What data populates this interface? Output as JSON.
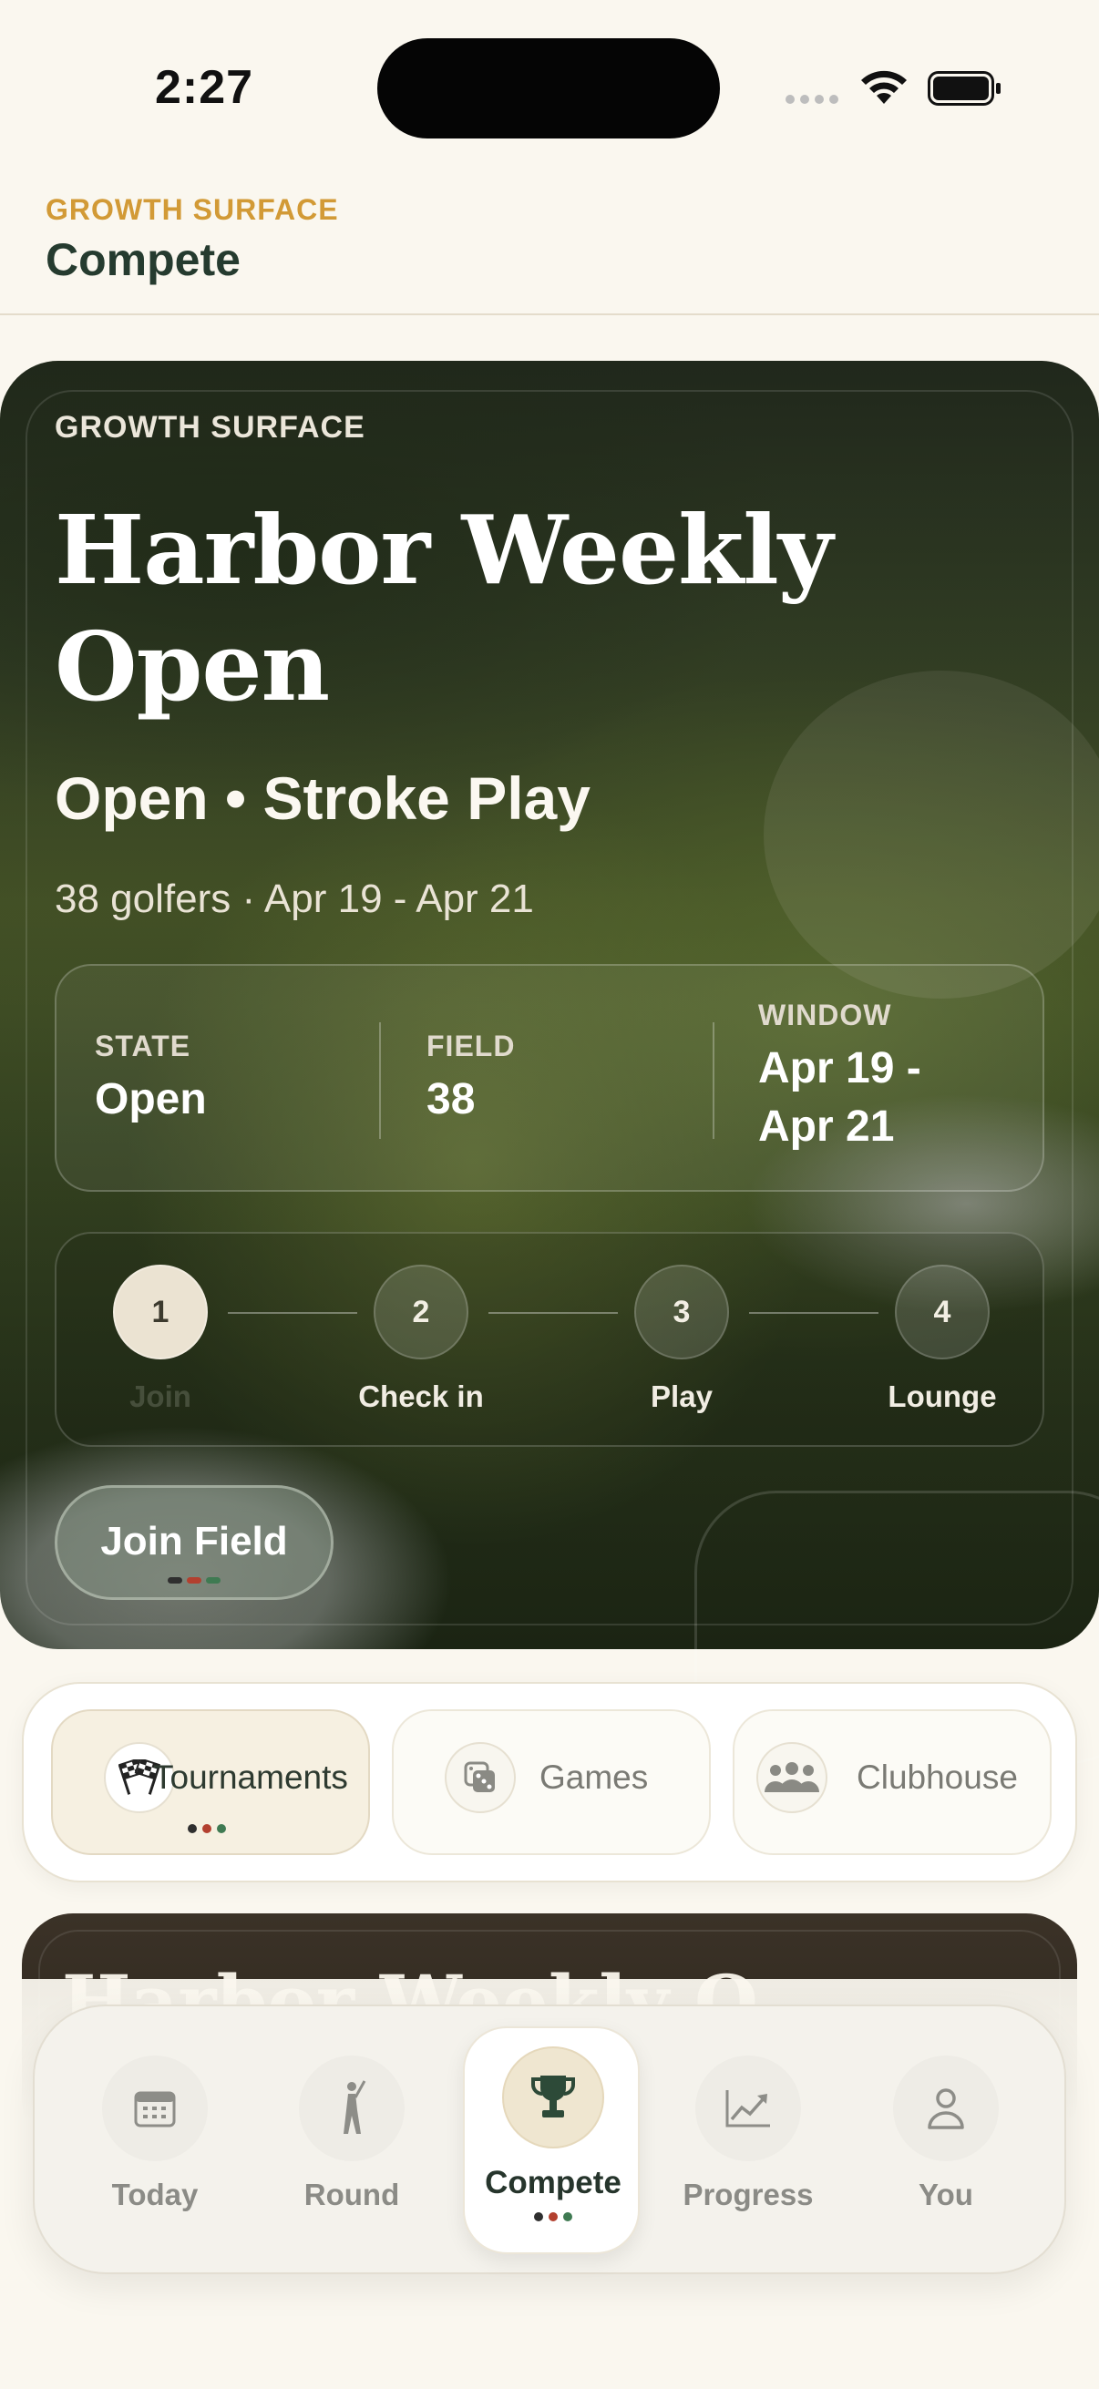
{
  "status_bar": {
    "time": "2:27"
  },
  "header": {
    "eyebrow": "GROWTH SURFACE",
    "title": "Compete"
  },
  "hero": {
    "eyebrow": "GROWTH SURFACE",
    "title": "Harbor Weekly Open",
    "subtitle": "Open • Stroke Play",
    "meta": "38 golfers · Apr 19 - Apr 21",
    "stats": [
      {
        "label": "STATE",
        "value": "Open"
      },
      {
        "label": "FIELD",
        "value": "38"
      },
      {
        "label": "WINDOW",
        "value": "Apr 19 - Apr 21"
      }
    ],
    "steps": [
      {
        "number": "1",
        "label": "Join",
        "active": true
      },
      {
        "number": "2",
        "label": "Check in"
      },
      {
        "number": "3",
        "label": "Play"
      },
      {
        "number": "4",
        "label": "Lounge"
      }
    ],
    "cta_label": "Join Field"
  },
  "segments": [
    {
      "label": "Tournaments",
      "icon": "checkered-flags-icon",
      "selected": true
    },
    {
      "label": "Games",
      "icon": "dice-icon"
    },
    {
      "label": "Clubhouse",
      "icon": "people-icon"
    }
  ],
  "next_card": {
    "title_partial": "Harbor Weekly O..."
  },
  "bottom_nav": [
    {
      "label": "Today",
      "icon": "calendar-icon"
    },
    {
      "label": "Round",
      "icon": "golfer-icon"
    },
    {
      "label": "Compete",
      "icon": "trophy-icon",
      "selected": true
    },
    {
      "label": "Progress",
      "icon": "trend-chart-icon"
    },
    {
      "label": "You",
      "icon": "person-icon"
    }
  ],
  "colors": {
    "accent_gold": "#d29a36",
    "title_green": "#253b2f",
    "indicator_dark": "#2f2f2f",
    "indicator_red": "#b3402f",
    "indicator_green": "#3f7a52"
  }
}
